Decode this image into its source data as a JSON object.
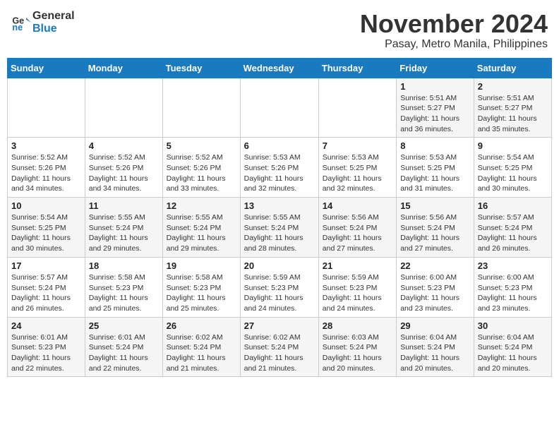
{
  "header": {
    "logo_line1": "General",
    "logo_line2": "Blue",
    "main_title": "November 2024",
    "subtitle": "Pasay, Metro Manila, Philippines"
  },
  "calendar": {
    "headers": [
      "Sunday",
      "Monday",
      "Tuesday",
      "Wednesday",
      "Thursday",
      "Friday",
      "Saturday"
    ],
    "weeks": [
      [
        {
          "day": "",
          "info": ""
        },
        {
          "day": "",
          "info": ""
        },
        {
          "day": "",
          "info": ""
        },
        {
          "day": "",
          "info": ""
        },
        {
          "day": "",
          "info": ""
        },
        {
          "day": "1",
          "info": "Sunrise: 5:51 AM\nSunset: 5:27 PM\nDaylight: 11 hours\nand 36 minutes."
        },
        {
          "day": "2",
          "info": "Sunrise: 5:51 AM\nSunset: 5:27 PM\nDaylight: 11 hours\nand 35 minutes."
        }
      ],
      [
        {
          "day": "3",
          "info": "Sunrise: 5:52 AM\nSunset: 5:26 PM\nDaylight: 11 hours\nand 34 minutes."
        },
        {
          "day": "4",
          "info": "Sunrise: 5:52 AM\nSunset: 5:26 PM\nDaylight: 11 hours\nand 34 minutes."
        },
        {
          "day": "5",
          "info": "Sunrise: 5:52 AM\nSunset: 5:26 PM\nDaylight: 11 hours\nand 33 minutes."
        },
        {
          "day": "6",
          "info": "Sunrise: 5:53 AM\nSunset: 5:26 PM\nDaylight: 11 hours\nand 32 minutes."
        },
        {
          "day": "7",
          "info": "Sunrise: 5:53 AM\nSunset: 5:25 PM\nDaylight: 11 hours\nand 32 minutes."
        },
        {
          "day": "8",
          "info": "Sunrise: 5:53 AM\nSunset: 5:25 PM\nDaylight: 11 hours\nand 31 minutes."
        },
        {
          "day": "9",
          "info": "Sunrise: 5:54 AM\nSunset: 5:25 PM\nDaylight: 11 hours\nand 30 minutes."
        }
      ],
      [
        {
          "day": "10",
          "info": "Sunrise: 5:54 AM\nSunset: 5:25 PM\nDaylight: 11 hours\nand 30 minutes."
        },
        {
          "day": "11",
          "info": "Sunrise: 5:55 AM\nSunset: 5:24 PM\nDaylight: 11 hours\nand 29 minutes."
        },
        {
          "day": "12",
          "info": "Sunrise: 5:55 AM\nSunset: 5:24 PM\nDaylight: 11 hours\nand 29 minutes."
        },
        {
          "day": "13",
          "info": "Sunrise: 5:55 AM\nSunset: 5:24 PM\nDaylight: 11 hours\nand 28 minutes."
        },
        {
          "day": "14",
          "info": "Sunrise: 5:56 AM\nSunset: 5:24 PM\nDaylight: 11 hours\nand 27 minutes."
        },
        {
          "day": "15",
          "info": "Sunrise: 5:56 AM\nSunset: 5:24 PM\nDaylight: 11 hours\nand 27 minutes."
        },
        {
          "day": "16",
          "info": "Sunrise: 5:57 AM\nSunset: 5:24 PM\nDaylight: 11 hours\nand 26 minutes."
        }
      ],
      [
        {
          "day": "17",
          "info": "Sunrise: 5:57 AM\nSunset: 5:24 PM\nDaylight: 11 hours\nand 26 minutes."
        },
        {
          "day": "18",
          "info": "Sunrise: 5:58 AM\nSunset: 5:23 PM\nDaylight: 11 hours\nand 25 minutes."
        },
        {
          "day": "19",
          "info": "Sunrise: 5:58 AM\nSunset: 5:23 PM\nDaylight: 11 hours\nand 25 minutes."
        },
        {
          "day": "20",
          "info": "Sunrise: 5:59 AM\nSunset: 5:23 PM\nDaylight: 11 hours\nand 24 minutes."
        },
        {
          "day": "21",
          "info": "Sunrise: 5:59 AM\nSunset: 5:23 PM\nDaylight: 11 hours\nand 24 minutes."
        },
        {
          "day": "22",
          "info": "Sunrise: 6:00 AM\nSunset: 5:23 PM\nDaylight: 11 hours\nand 23 minutes."
        },
        {
          "day": "23",
          "info": "Sunrise: 6:00 AM\nSunset: 5:23 PM\nDaylight: 11 hours\nand 23 minutes."
        }
      ],
      [
        {
          "day": "24",
          "info": "Sunrise: 6:01 AM\nSunset: 5:23 PM\nDaylight: 11 hours\nand 22 minutes."
        },
        {
          "day": "25",
          "info": "Sunrise: 6:01 AM\nSunset: 5:24 PM\nDaylight: 11 hours\nand 22 minutes."
        },
        {
          "day": "26",
          "info": "Sunrise: 6:02 AM\nSunset: 5:24 PM\nDaylight: 11 hours\nand 21 minutes."
        },
        {
          "day": "27",
          "info": "Sunrise: 6:02 AM\nSunset: 5:24 PM\nDaylight: 11 hours\nand 21 minutes."
        },
        {
          "day": "28",
          "info": "Sunrise: 6:03 AM\nSunset: 5:24 PM\nDaylight: 11 hours\nand 20 minutes."
        },
        {
          "day": "29",
          "info": "Sunrise: 6:04 AM\nSunset: 5:24 PM\nDaylight: 11 hours\nand 20 minutes."
        },
        {
          "day": "30",
          "info": "Sunrise: 6:04 AM\nSunset: 5:24 PM\nDaylight: 11 hours\nand 20 minutes."
        }
      ]
    ]
  }
}
